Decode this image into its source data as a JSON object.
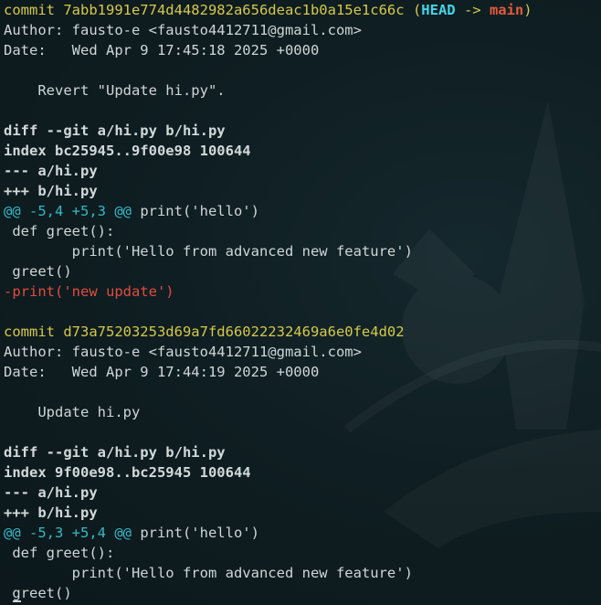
{
  "commits": [
    {
      "hash_line": "commit 7abb1991e774d4482982a656deac1b0a15e1c66c",
      "ref_open": " (",
      "head_label": "HEAD",
      "ref_arrow": " -> ",
      "branch": "main",
      "ref_close": ")",
      "author": "Author: fausto-e <fausto4412711@gmail.com>",
      "date": "Date:   Wed Apr 9 17:45:18 2025 +0000",
      "message": "    Revert \"Update hi.py\".",
      "diff_header": "diff --git a/hi.py b/hi.py",
      "index": "index bc25945..9f00e98 100644",
      "minus_file": "--- a/hi.py",
      "plus_file": "+++ b/hi.py",
      "hunk_marker": "@@ -5,4 +5,3 @@",
      "hunk_context": " print('hello')",
      "lines": [
        " def greet():",
        "        print('Hello from advanced new feature')",
        " greet()"
      ],
      "removed": "-print('new update')"
    },
    {
      "hash_line": "commit d73a75203253d69a7fd66022232469a6e0fe4d02",
      "author": "Author: fausto-e <fausto4412711@gmail.com>",
      "date": "Date:   Wed Apr 9 17:44:19 2025 +0000",
      "message": "    Update hi.py",
      "diff_header": "diff --git a/hi.py b/hi.py",
      "index": "index 9f00e98..bc25945 100644",
      "minus_file": "--- a/hi.py",
      "plus_file": "+++ b/hi.py",
      "hunk_marker": "@@ -5,3 +5,4 @@",
      "hunk_context": " print('hello')",
      "lines": [
        " def greet():",
        "        print('Hello from advanced new feature')",
        " greet()"
      ]
    }
  ],
  "colors": {
    "background": "#0e1b1f",
    "commit": "#d6c94a",
    "head": "#43d7e8",
    "branch": "#e25a3c",
    "hunk": "#34b9c8",
    "removed": "#e24b3e",
    "text": "#cfd6d8"
  }
}
